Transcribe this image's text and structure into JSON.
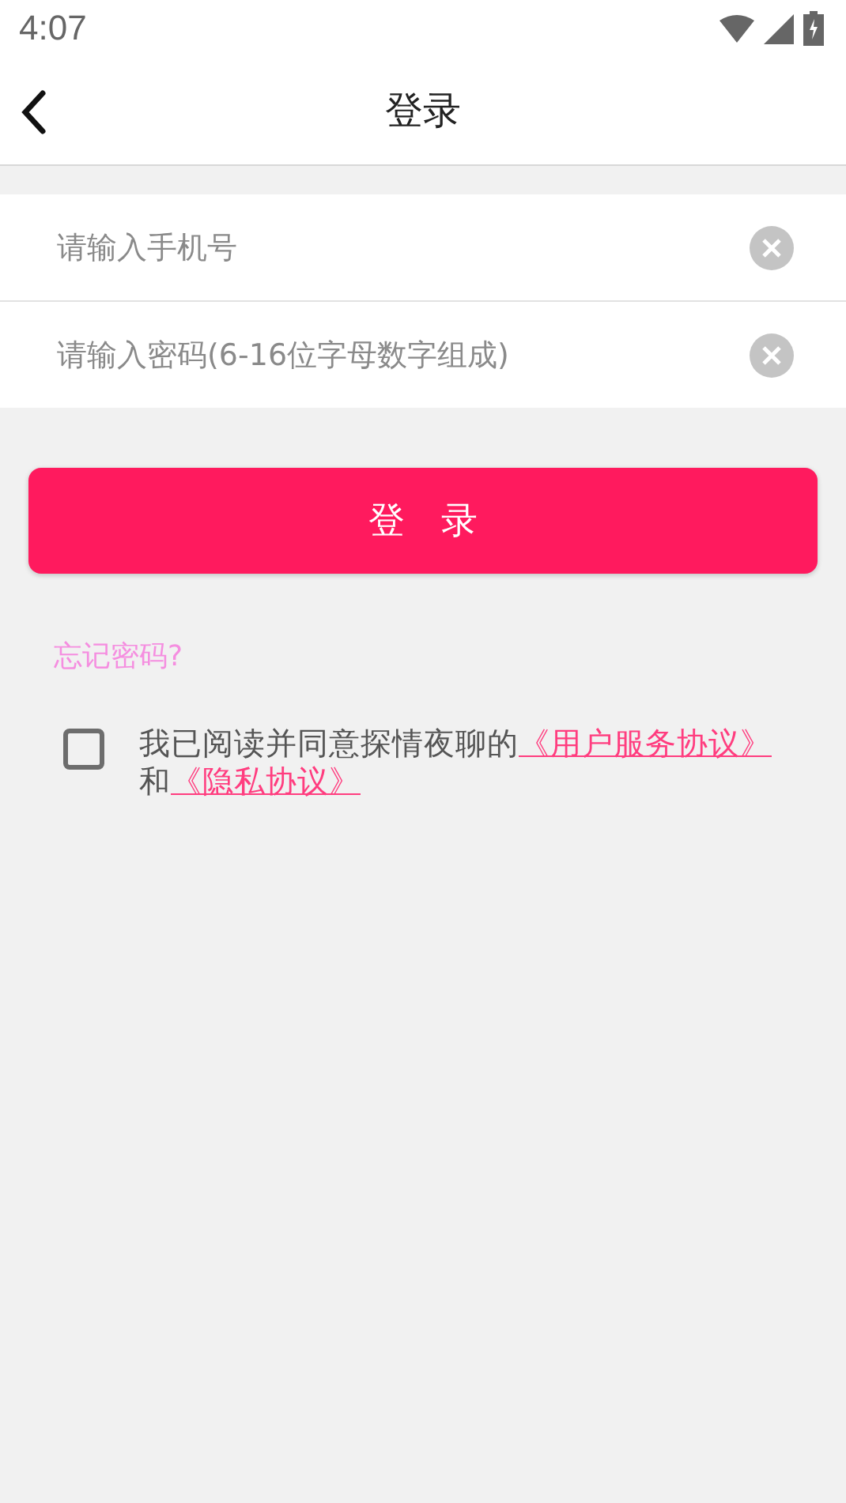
{
  "status_bar": {
    "time": "4:07"
  },
  "header": {
    "title": "登录"
  },
  "fields": [
    {
      "placeholder": "请输入手机号"
    },
    {
      "placeholder": "请输入密码(6-16位字母数字组成)"
    }
  ],
  "login_button": "登　录",
  "forgot_password": "忘记密码?",
  "agreement": {
    "checked": false,
    "parts": [
      {
        "kind": "text",
        "text": "我已阅读并同意探情夜聊的"
      },
      {
        "kind": "link",
        "text": "《用户服务协议》"
      },
      {
        "kind": "text",
        "text": "和"
      },
      {
        "kind": "link",
        "text": "《隐私协议》"
      }
    ]
  }
}
